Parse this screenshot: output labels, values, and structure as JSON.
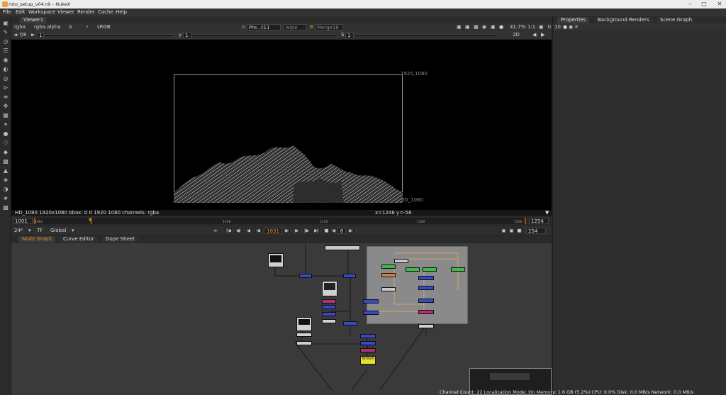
{
  "window": {
    "title": "roto_setup_v04.nk - NukeX"
  },
  "menu": [
    "File",
    "Edit",
    "Workspace",
    "Viewer",
    "Render",
    "Cache",
    "Help"
  ],
  "viewer": {
    "tab_label": "Viewer1",
    "channels": "rgba",
    "alpha_channel": "rgba.alpha",
    "input_a": "A",
    "colorspace": "sRGB",
    "input_a_node": "Pre...t11",
    "wipe_label": "wipe",
    "input_b_label": "B",
    "input_b_node": "Merge16",
    "zoom": "41.7%",
    "ratio": "1:1",
    "view_mode": "2D",
    "frame_stop": "f/8",
    "gain_value": "1",
    "gamma_label": "y",
    "gamma_value": "1",
    "sat_label": "S",
    "sat_value": "1",
    "format_top_right": "1920,1080",
    "format_bottom_right": "HD_1080",
    "status_left": "HD_1080 1920x1080  bbox: 0 0 1920 1080 channels: rgba",
    "status_coords": "x=1246 y=-58"
  },
  "timeline": {
    "start": "1001",
    "end": "1254",
    "out_end": "254",
    "ticks": [
      "1001",
      "1100",
      "1150",
      "1200",
      "1250"
    ],
    "fps": "24*",
    "tf_label": "TF",
    "scope": "Global",
    "current_frame": "1031",
    "step": "8"
  },
  "nodegraph_tabs": [
    "Node Graph",
    "Curve Editor",
    "Dope Sheet"
  ],
  "right_panel": {
    "tabs": [
      "Properties",
      "Background Renders",
      "Scene Graph"
    ],
    "props_count": "10"
  },
  "nodegraph_labels": {
    "write_node": "Write4"
  },
  "status_bar": "Channel Count: 22  Localization Mode: On  Memory: 1.6 GB (5.2%)  CPU: 0.0%  Disk: 0.0 MB/s  Network: 0.0 MB/s",
  "colors": {
    "accent_orange": "#e28a1e",
    "viewer_bg": "#000000",
    "node_blue": "#3848c8",
    "node_green": "#3dbb46",
    "node_yellow": "#e6e02a",
    "node_pink": "#b0307a",
    "backdrop_gray": "#8a8a8a"
  }
}
